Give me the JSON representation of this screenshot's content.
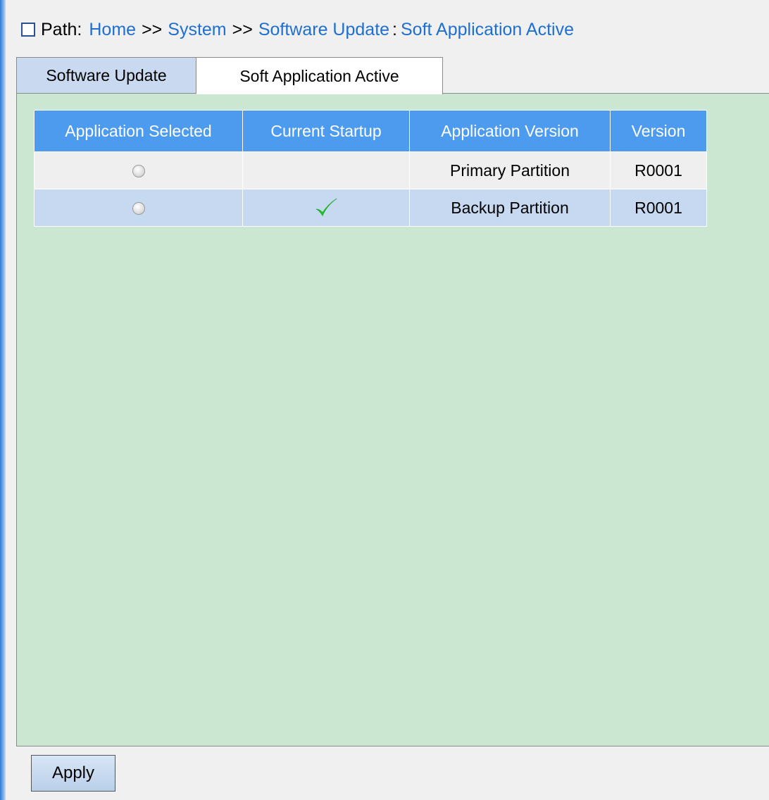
{
  "breadcrumb": {
    "label": "Path:",
    "items": [
      "Home",
      "System",
      "Software Update"
    ],
    "separator": ">>",
    "current": "Soft Application Active",
    "icon": "window-icon"
  },
  "tabs": [
    {
      "label": "Software Update",
      "active": false
    },
    {
      "label": "Soft Application Active",
      "active": true
    }
  ],
  "table": {
    "headers": [
      "Application Selected",
      "Current Startup",
      "Application Version",
      "Version"
    ],
    "rows": [
      {
        "selected": false,
        "current_startup": false,
        "application_version": "Primary Partition",
        "version": "R0001"
      },
      {
        "selected": false,
        "current_startup": true,
        "application_version": "Backup Partition",
        "version": "R0001"
      }
    ],
    "check_icon": "checkmark-icon"
  },
  "buttons": {
    "apply": "Apply"
  },
  "colors": {
    "header_bg": "#4d9bef",
    "panel_bg": "#cce7d1",
    "link": "#1f6fd1",
    "check": "#22d12b"
  }
}
